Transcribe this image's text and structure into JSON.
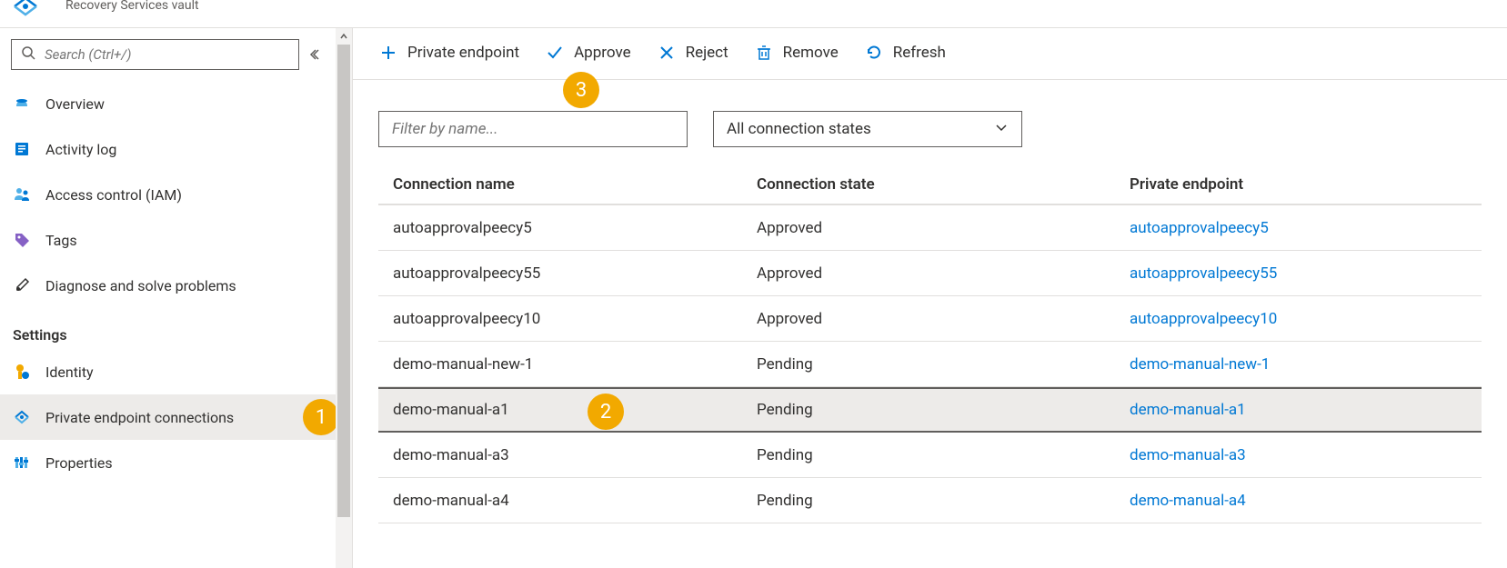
{
  "header": {
    "subtitle": "Recovery Services vault"
  },
  "sidebar": {
    "search_placeholder": "Search (Ctrl+/)",
    "items_top": [
      {
        "label": "Overview"
      },
      {
        "label": "Activity log"
      },
      {
        "label": "Access control (IAM)"
      },
      {
        "label": "Tags"
      },
      {
        "label": "Diagnose and solve problems"
      }
    ],
    "group_settings_title": "Settings",
    "items_settings": [
      {
        "label": "Identity"
      },
      {
        "label": "Private endpoint connections"
      },
      {
        "label": "Properties"
      }
    ]
  },
  "toolbar": {
    "private_endpoint": "Private endpoint",
    "approve": "Approve",
    "reject": "Reject",
    "remove": "Remove",
    "refresh": "Refresh"
  },
  "filters": {
    "name_placeholder": "Filter by name...",
    "state_selected": "All connection states"
  },
  "table": {
    "columns": {
      "name": "Connection name",
      "state": "Connection state",
      "endpoint": "Private endpoint"
    },
    "rows": [
      {
        "name": "autoapprovalpeecy5",
        "state": "Approved",
        "endpoint": "autoapprovalpeecy5"
      },
      {
        "name": "autoapprovalpeecy55",
        "state": "Approved",
        "endpoint": "autoapprovalpeecy55"
      },
      {
        "name": "autoapprovalpeecy10",
        "state": "Approved",
        "endpoint": "autoapprovalpeecy10"
      },
      {
        "name": "demo-manual-new-1",
        "state": "Pending",
        "endpoint": "demo-manual-new-1"
      },
      {
        "name": "demo-manual-a1",
        "state": "Pending",
        "endpoint": "demo-manual-a1"
      },
      {
        "name": "demo-manual-a3",
        "state": "Pending",
        "endpoint": "demo-manual-a3"
      },
      {
        "name": "demo-manual-a4",
        "state": "Pending",
        "endpoint": "demo-manual-a4"
      }
    ],
    "selected_index": 4
  },
  "callouts": {
    "one": "1",
    "two": "2",
    "three": "3"
  }
}
